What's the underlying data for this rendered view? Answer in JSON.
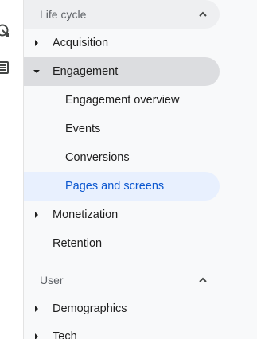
{
  "nav": {
    "lifecycle": {
      "title": "Life cycle",
      "items": [
        {
          "label": "Acquisition"
        },
        {
          "label": "Engagement"
        },
        {
          "label": "Engagement overview"
        },
        {
          "label": "Events"
        },
        {
          "label": "Conversions"
        },
        {
          "label": "Pages and screens"
        },
        {
          "label": "Monetization"
        },
        {
          "label": "Retention"
        }
      ]
    },
    "user": {
      "title": "User",
      "items": [
        {
          "label": "Demographics"
        },
        {
          "label": "Tech"
        }
      ]
    }
  },
  "rail_icons": [
    "explore-icon",
    "reports-list-icon"
  ],
  "colors": {
    "active_bg": "#e8f0fe",
    "active_text": "#0b57d0",
    "selected_parent_bg": "#dcdde0",
    "header_bg": "#eeeff1"
  }
}
